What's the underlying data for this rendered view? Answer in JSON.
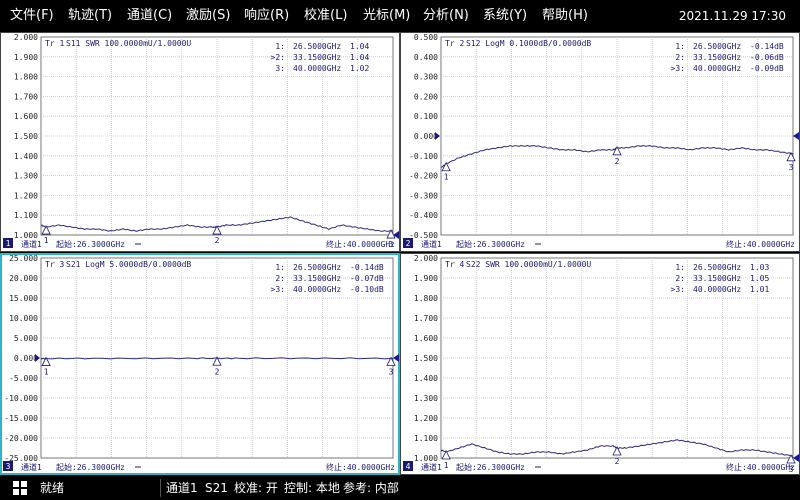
{
  "menu": {
    "items": [
      "文件(F)",
      "轨迹(T)",
      "通道(C)",
      "激励(S)",
      "响应(R)",
      "校准(L)",
      "光标(M)",
      "分析(N)",
      "系统(Y)",
      "帮助(H)"
    ],
    "datetime": "2021.11.29 17:30"
  },
  "status": {
    "ready": "就绪",
    "channel": "通道1",
    "param": "S21",
    "cal": "校准: 开",
    "control": "控制: 本地",
    "ref": "参考: 内部"
  },
  "colors": {
    "trace": "#2b2b7a",
    "active_border": "#2ab6c4",
    "grid": "#c8c8c8",
    "panel_bg": "#ffffff",
    "text": "#1a1a6e"
  },
  "panels": [
    {
      "number": "1",
      "trace_label": "Tr 1",
      "trace_desc": "S11 SWR 100.0000mU/1.0000U",
      "active": false,
      "yticks": [
        "2.000",
        "1.900",
        "1.800",
        "1.700",
        "1.600",
        "1.500",
        "1.400",
        "1.300",
        "1.200",
        "1.100",
        "1.000"
      ],
      "channel": "通道1",
      "start": "起始:26.3000GHz",
      "stop": "终止:40.0000GHz",
      "markers": [
        {
          "label": "1:",
          "freq": "26.5000GHz",
          "value": "1.04",
          "active": false
        },
        {
          "label": "2:",
          "freq": "33.1500GHz",
          "value": "1.04",
          "active": true
        },
        {
          "label": "3:",
          "freq": "40.0000GHz",
          "value": "1.02",
          "active": false
        }
      ]
    },
    {
      "number": "2",
      "trace_label": "Tr 2",
      "trace_desc": "S12 LogM 0.1000dB/0.0000dB",
      "active": false,
      "yticks": [
        "0.500",
        "0.400",
        "0.300",
        "0.200",
        "0.100",
        "0.000",
        "-0.100",
        "-0.200",
        "-0.300",
        "-0.400",
        "-0.500"
      ],
      "channel": "通道1",
      "start": "起始:26.3000GHz",
      "stop": "终止:40.0000GHz",
      "markers": [
        {
          "label": "1:",
          "freq": "26.5000GHz",
          "value": "-0.14dB",
          "active": false
        },
        {
          "label": "2:",
          "freq": "33.1500GHz",
          "value": "-0.06dB",
          "active": false
        },
        {
          "label": "3:",
          "freq": "40.0000GHz",
          "value": "-0.09dB",
          "active": true
        }
      ]
    },
    {
      "number": "3",
      "trace_label": "Tr 3",
      "trace_desc": "S21 LogM 5.0000dB/0.0000dB",
      "active": true,
      "yticks": [
        "25.000",
        "20.000",
        "15.000",
        "10.000",
        "5.000",
        "0.000",
        "-5.000",
        "-10.000",
        "-15.000",
        "-20.000",
        "-25.000"
      ],
      "channel": "通道1",
      "start": "起始:26.3000GHz",
      "stop": "终止:40.0000GHz",
      "markers": [
        {
          "label": "1:",
          "freq": "26.5000GHz",
          "value": "-0.14dB",
          "active": false
        },
        {
          "label": "2:",
          "freq": "33.1500GHz",
          "value": "-0.07dB",
          "active": false
        },
        {
          "label": "3:",
          "freq": "40.0000GHz",
          "value": "-0.10dB",
          "active": true
        }
      ]
    },
    {
      "number": "4",
      "trace_label": "Tr 4",
      "trace_desc": "S22 SWR 100.0000mU/1.0000U",
      "active": false,
      "yticks": [
        "2.000",
        "1.900",
        "1.800",
        "1.700",
        "1.600",
        "1.500",
        "1.400",
        "1.300",
        "1.200",
        "1.100",
        "1.000"
      ],
      "channel": "通道1",
      "start": "起始:26.3000GHz",
      "stop": "终止:40.0000GHz",
      "markers": [
        {
          "label": "1:",
          "freq": "26.5000GHz",
          "value": "1.03",
          "active": false
        },
        {
          "label": "2:",
          "freq": "33.1500GHz",
          "value": "1.05",
          "active": false
        },
        {
          "label": "3:",
          "freq": "40.0000GHz",
          "value": "1.01",
          "active": true
        }
      ]
    }
  ],
  "chart_data": [
    {
      "type": "line",
      "ylim": [
        1.0,
        2.0
      ],
      "xlim": [
        26.3,
        40.0
      ],
      "series": [
        {
          "x": [
            26.3,
            26.5,
            27.0,
            27.5,
            28.0,
            28.5,
            29.0,
            29.5,
            30.0,
            30.5,
            31.0,
            31.5,
            32.0,
            32.5,
            33.0,
            33.15,
            33.5,
            34.0,
            34.5,
            35.0,
            35.5,
            36.0,
            36.5,
            37.0,
            37.5,
            38.0,
            38.5,
            39.0,
            39.5,
            40.0
          ],
          "values": [
            1.05,
            1.04,
            1.05,
            1.04,
            1.03,
            1.03,
            1.02,
            1.03,
            1.02,
            1.03,
            1.03,
            1.04,
            1.05,
            1.04,
            1.04,
            1.04,
            1.05,
            1.05,
            1.06,
            1.07,
            1.08,
            1.09,
            1.07,
            1.05,
            1.03,
            1.05,
            1.04,
            1.03,
            1.02,
            1.02
          ]
        }
      ],
      "markers": [
        {
          "x": 26.5,
          "y": 1.04
        },
        {
          "x": 33.15,
          "y": 1.04
        },
        {
          "x": 40.0,
          "y": 1.02
        }
      ]
    },
    {
      "type": "line",
      "ylim": [
        -0.5,
        0.5
      ],
      "xlim": [
        26.3,
        40.0
      ],
      "series": [
        {
          "x": [
            26.3,
            26.5,
            27.0,
            27.5,
            28.0,
            28.5,
            29.0,
            29.5,
            30.0,
            30.5,
            31.0,
            31.5,
            32.0,
            32.5,
            33.0,
            33.15,
            33.5,
            34.0,
            34.5,
            35.0,
            35.5,
            36.0,
            36.5,
            37.0,
            37.5,
            38.0,
            38.5,
            39.0,
            39.5,
            40.0
          ],
          "values": [
            -0.16,
            -0.14,
            -0.11,
            -0.09,
            -0.07,
            -0.06,
            -0.05,
            -0.05,
            -0.05,
            -0.06,
            -0.07,
            -0.07,
            -0.08,
            -0.07,
            -0.07,
            -0.06,
            -0.06,
            -0.05,
            -0.05,
            -0.06,
            -0.06,
            -0.07,
            -0.06,
            -0.06,
            -0.07,
            -0.06,
            -0.07,
            -0.07,
            -0.08,
            -0.09
          ]
        }
      ],
      "markers": [
        {
          "x": 26.5,
          "y": -0.14
        },
        {
          "x": 33.15,
          "y": -0.06
        },
        {
          "x": 40.0,
          "y": -0.09
        }
      ]
    },
    {
      "type": "line",
      "ylim": [
        -25,
        25
      ],
      "xlim": [
        26.3,
        40.0
      ],
      "series": [
        {
          "x": [
            26.3,
            26.5,
            28.0,
            30.0,
            32.0,
            33.15,
            34.0,
            36.0,
            38.0,
            40.0
          ],
          "values": [
            -0.15,
            -0.14,
            -0.1,
            -0.1,
            -0.08,
            -0.07,
            -0.08,
            -0.06,
            -0.08,
            -0.1
          ]
        }
      ],
      "markers": [
        {
          "x": 26.5,
          "y": -0.14
        },
        {
          "x": 33.15,
          "y": -0.07
        },
        {
          "x": 40.0,
          "y": -0.1
        }
      ]
    },
    {
      "type": "line",
      "ylim": [
        1.0,
        2.0
      ],
      "xlim": [
        26.3,
        40.0
      ],
      "series": [
        {
          "x": [
            26.3,
            26.5,
            27.0,
            27.5,
            28.0,
            28.5,
            29.0,
            29.5,
            30.0,
            30.5,
            31.0,
            31.5,
            32.0,
            32.5,
            33.0,
            33.15,
            33.5,
            34.0,
            34.5,
            35.0,
            35.5,
            36.0,
            36.5,
            37.0,
            37.5,
            38.0,
            38.5,
            39.0,
            39.5,
            40.0
          ],
          "values": [
            1.04,
            1.03,
            1.05,
            1.07,
            1.05,
            1.03,
            1.02,
            1.02,
            1.03,
            1.03,
            1.02,
            1.03,
            1.04,
            1.06,
            1.06,
            1.05,
            1.05,
            1.06,
            1.07,
            1.08,
            1.09,
            1.08,
            1.07,
            1.05,
            1.03,
            1.04,
            1.04,
            1.03,
            1.02,
            1.01
          ]
        }
      ],
      "markers": [
        {
          "x": 26.5,
          "y": 1.03
        },
        {
          "x": 33.15,
          "y": 1.05
        },
        {
          "x": 40.0,
          "y": 1.01
        }
      ]
    }
  ]
}
